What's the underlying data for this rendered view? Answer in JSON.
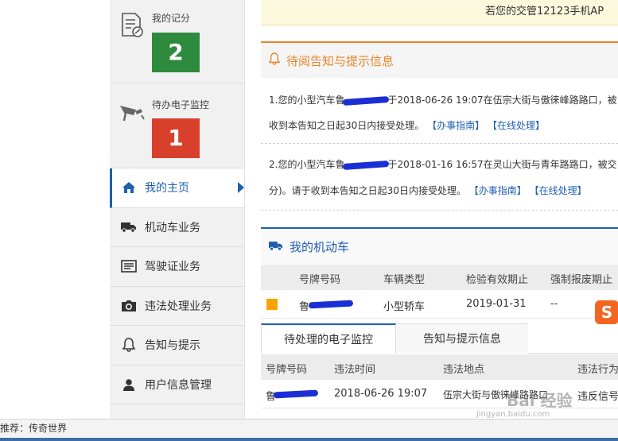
{
  "notice_bar": {
    "text": "若您的交管12123手机AP"
  },
  "sidebar": {
    "score": {
      "label": "我的记分",
      "value": "2"
    },
    "monitor": {
      "label": "待办电子监控",
      "value": "1"
    },
    "items": [
      {
        "label": "我的主页",
        "icon": "home-icon",
        "active": true
      },
      {
        "label": "机动车业务",
        "icon": "truck-icon"
      },
      {
        "label": "驾驶证业务",
        "icon": "license-card-icon"
      },
      {
        "label": "违法处理业务",
        "icon": "camera-icon"
      },
      {
        "label": "告知与提示",
        "icon": "bell-icon"
      },
      {
        "label": "用户信息管理",
        "icon": "user-icon"
      }
    ]
  },
  "notices": {
    "title": "待阅告知与提示信息",
    "msg1": {
      "prefix": "1.您的小型汽车鲁",
      "mid": "于2018-06-26 19:07在伍宗大街与傲徕峰路路口，被",
      "line2": "收到本告知之日起30日内接受处理。",
      "link_guide": "【办事指南】",
      "link_online": "【在线处理】"
    },
    "msg2": {
      "prefix": "2.您的小型汽车鲁",
      "mid": "于2018-01-16 16:57在灵山大街与青年路路口，被交",
      "line2": "分)。请于收到本告知之日起30日内接受处理。",
      "link_guide": "【办事指南】",
      "link_online": "【在线处理】"
    }
  },
  "vehicles": {
    "title": "我的机动车",
    "headers": [
      "号牌号码",
      "车辆类型",
      "检验有效期止",
      "强制报废期止"
    ],
    "row": {
      "plate": "鲁",
      "type": "小型轿车",
      "inspection": "2019-01-31",
      "scrap": "--"
    }
  },
  "tabs": {
    "active": "待处理的电子监控",
    "inactive": "告知与提示信息"
  },
  "monitor_table": {
    "headers": [
      "号牌号码",
      "违法时间",
      "违法地点",
      "违法行为"
    ],
    "row": {
      "plate": "鲁",
      "time": "2018-06-26 19:07",
      "place": "伍宗大街与傲徕峰路路口",
      "act": "违反信号"
    }
  },
  "sogou": {
    "label": "S"
  },
  "statusbar": {
    "text": "推荐：传奇世界"
  },
  "watermark": {
    "line1": "Bai 经验",
    "line2": "jingyan.baidu.com"
  },
  "colors": {
    "accent_blue": "#1f5fb0",
    "accent_orange": "#e8862a",
    "score_green": "#2e8b3d",
    "monitor_red": "#d9402b"
  }
}
